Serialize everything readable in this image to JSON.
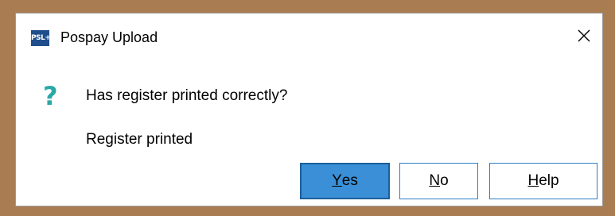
{
  "window": {
    "title": "Pospay Upload",
    "app_icon_text": "PSL+",
    "close_icon": "close-icon"
  },
  "message": {
    "icon": "question-icon",
    "question": "Has register printed correctly?",
    "detail": "Register printed"
  },
  "buttons": {
    "yes": {
      "mnemonic": "Y",
      "rest": "es"
    },
    "no": {
      "mnemonic": "N",
      "rest": "o"
    },
    "help": {
      "mnemonic": "H",
      "rest": "elp"
    }
  },
  "colors": {
    "background": "#a97c52",
    "primary_button": "#3a8fd6",
    "button_border": "#2b7fc4",
    "question_icon": "#2aa8a8",
    "app_icon_bg": "#1f4e8c"
  }
}
